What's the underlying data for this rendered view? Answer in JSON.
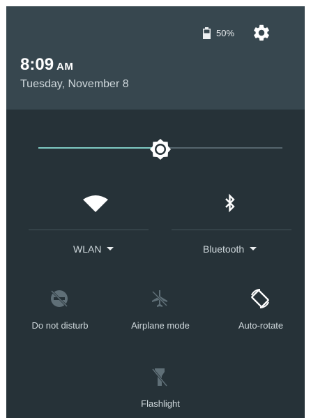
{
  "status": {
    "battery_text": "50%",
    "icons": [
      "battery-icon",
      "settings-gear-icon"
    ]
  },
  "clock": {
    "time": "8:09",
    "ampm": "AM",
    "date": "Tuesday, November 8"
  },
  "brightness": {
    "level": 0.5,
    "icon": "brightness-icon"
  },
  "tiles": {
    "wlan": {
      "label": "WLAN",
      "icon": "wifi-icon",
      "on": true
    },
    "bluetooth": {
      "label": "Bluetooth",
      "icon": "bluetooth-icon",
      "on": true
    },
    "dnd": {
      "label": "Do not disturb",
      "icon": "do-not-disturb-icon",
      "on": false
    },
    "airplane": {
      "label": "Airplane mode",
      "icon": "airplane-icon",
      "on": false
    },
    "autorotate": {
      "label": "Auto-rotate",
      "icon": "auto-rotate-icon",
      "on": true
    },
    "flashlight": {
      "label": "Flashlight",
      "icon": "flashlight-icon",
      "on": false
    }
  },
  "colors": {
    "header": "#37474f",
    "panel": "#263238",
    "accent": "#80cbc4",
    "icon_on": "#ffffff",
    "icon_off": "#5f6f77"
  }
}
